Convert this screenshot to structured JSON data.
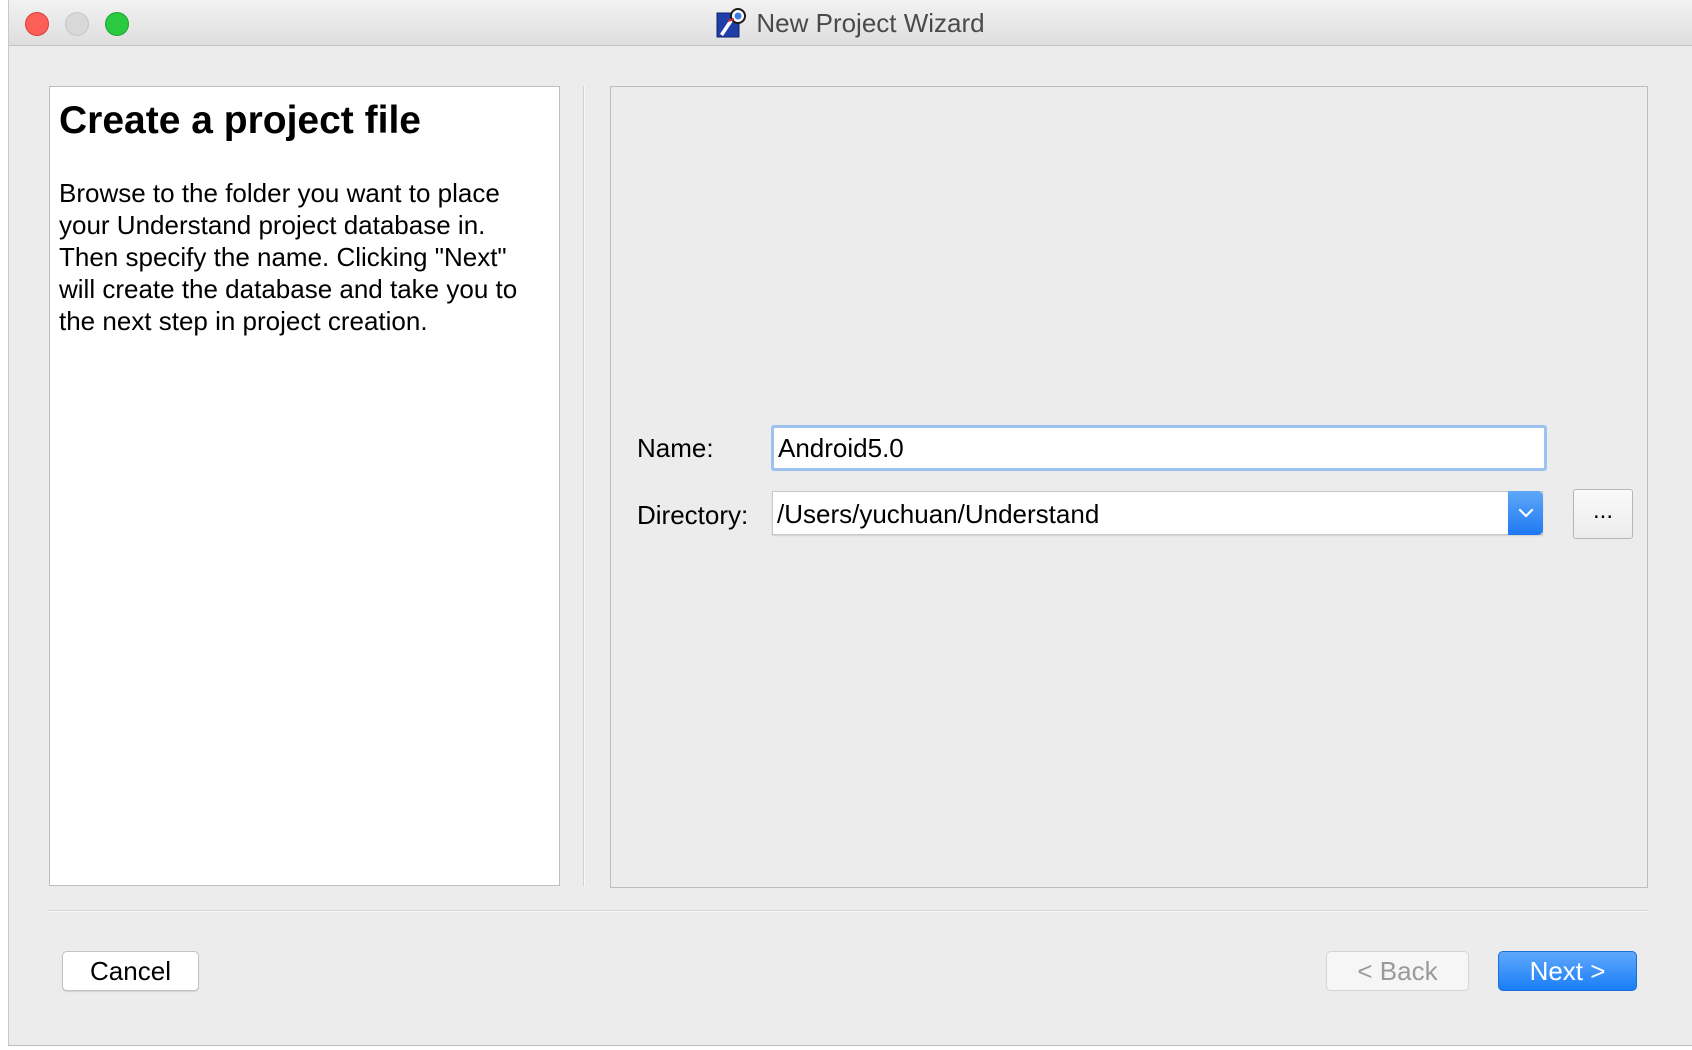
{
  "window": {
    "title": "New Project Wizard",
    "app_icon": "understand-app-icon"
  },
  "left_panel": {
    "heading": "Create a project file",
    "description": "Browse to the folder you want to place your Understand project database in. Then specify the name. Clicking \"Next\" will create the database and take you to the next step in project creation."
  },
  "form": {
    "name_label": "Name:",
    "name_value": "Android5.0",
    "directory_label": "Directory:",
    "directory_value": "/Users/yuchuan/Understand",
    "browse_label": "..."
  },
  "buttons": {
    "cancel": "Cancel",
    "back": "< Back",
    "next": "Next >"
  },
  "colors": {
    "accent": "#1a7ef6",
    "close": "#fc5f57",
    "zoom": "#2ac940"
  }
}
